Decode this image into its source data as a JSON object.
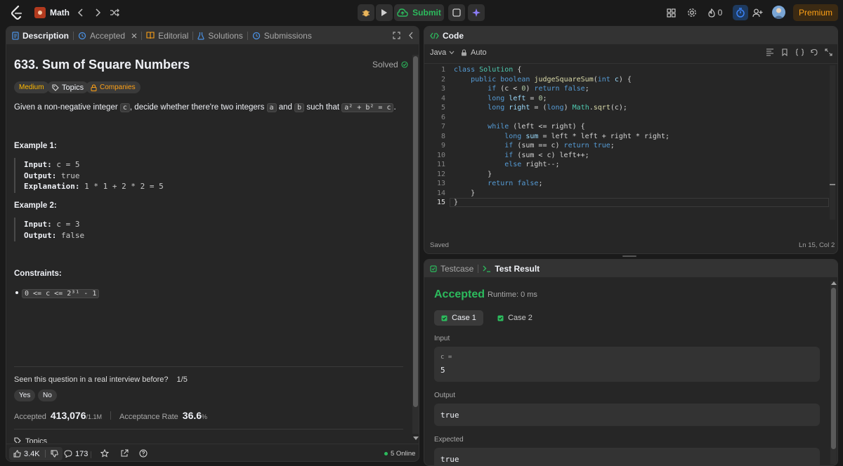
{
  "topbar": {
    "problem_list_label": "Math",
    "submit_label": "Submit",
    "streak_count": "0",
    "premium_label": "Premium"
  },
  "left_panel": {
    "tabs": [
      {
        "label": "Description"
      },
      {
        "label": "Accepted"
      },
      {
        "label": "Editorial"
      },
      {
        "label": "Solutions"
      },
      {
        "label": "Submissions"
      }
    ],
    "title": "633. Sum of Square Numbers",
    "solved_label": "Solved",
    "tags": {
      "difficulty": "Medium",
      "topics": "Topics",
      "companies": "Companies"
    },
    "desc": {
      "p1": "Given a non-negative integer ",
      "c": "c",
      "p2": ", decide whether there're two integers ",
      "a": "a",
      "p3": " and ",
      "b": "b",
      "p4": " such that ",
      "eq": "a² + b² = c",
      "p5": "."
    },
    "example1": {
      "heading": "Example 1:",
      "input_label": "Input:",
      "input_val": " c = 5",
      "output_label": "Output:",
      "output_val": " true",
      "expl_label": "Explanation:",
      "expl_val": " 1 * 1 + 2 * 2 = 5"
    },
    "example2": {
      "heading": "Example 2:",
      "input_label": "Input:",
      "input_val": " c = 3",
      "output_label": "Output:",
      "output_val": " false"
    },
    "constraints": {
      "heading": "Constraints:",
      "item": "0 <= c <= 2³¹ - 1"
    },
    "interview": {
      "question": "Seen this question in a real interview before?",
      "count": "1/5",
      "yes": "Yes",
      "no": "No"
    },
    "stats": {
      "accepted_label": "Accepted",
      "accepted_value": "413,076",
      "accepted_total": "/1.1M",
      "rate_label": "Acceptance Rate",
      "rate_value": "36.6",
      "rate_unit": "%"
    },
    "topics_footer": "Topics",
    "footer": {
      "likes": "3.4K",
      "comments": "173",
      "online": "5 Online"
    }
  },
  "code_panel": {
    "title": "Code",
    "language": "Java",
    "mode": "Auto",
    "status": "Saved",
    "cursor": "Ln 15, Col 2",
    "line_numbers": [
      "1",
      "2",
      "3",
      "4",
      "5",
      "6",
      "7",
      "8",
      "9",
      "10",
      "11",
      "12",
      "13",
      "14",
      "15"
    ]
  },
  "result_panel": {
    "tab_testcase": "Testcase",
    "tab_result": "Test Result",
    "verdict": "Accepted",
    "runtime": "Runtime: 0 ms",
    "case1": "Case 1",
    "case2": "Case 2",
    "input_label": "Input",
    "input_var": "c =",
    "input_val": "5",
    "output_label": "Output",
    "output_val": "true",
    "expected_label": "Expected",
    "expected_val": "true"
  },
  "colors": {
    "accent_green": "#2cbb5d",
    "medium_tag": "#ffb800",
    "premium": "#ffa116",
    "blue_icon": "#3b82f6"
  }
}
